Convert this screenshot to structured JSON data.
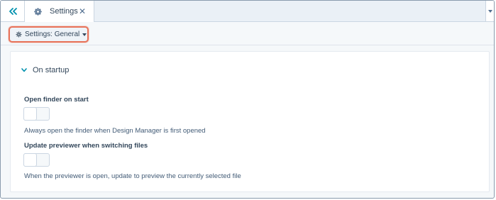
{
  "tabs": [
    {
      "label": "Settings",
      "icon": "gear-icon",
      "close": "✕"
    }
  ],
  "toolbar": {
    "settings_dropdown_label": "Settings: General",
    "highlight_color": "#e8735a"
  },
  "section": {
    "title": "On startup"
  },
  "settings": [
    {
      "label": "Open finder on start",
      "help": "Always open the finder when Design Manager is first opened",
      "enabled": false
    },
    {
      "label": "Update previewer when switching files",
      "help": "When the previewer is open, update to preview the currently selected file",
      "enabled": false
    }
  ],
  "colors": {
    "accent": "#0091ae",
    "text": "#33475b",
    "border": "#cbd6e2"
  }
}
